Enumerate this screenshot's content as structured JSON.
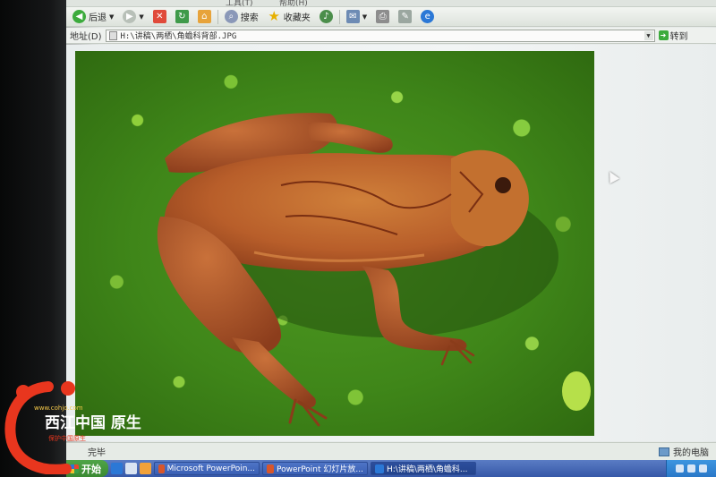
{
  "menubar": {
    "items": [
      "工具(T)",
      "帮助(H)"
    ]
  },
  "toolbar": {
    "back_label": "后退",
    "search_label": "搜索",
    "favorites_label": "收藏夹"
  },
  "address": {
    "label": "地址(D)",
    "value": "H:\\讲稿\\两栖\\角蟾科背部.JPG",
    "go_label": "转到"
  },
  "icons": {
    "back": "back-arrow-icon",
    "forward": "forward-arrow-icon",
    "stop": "stop-icon",
    "refresh": "refresh-icon",
    "home": "home-icon",
    "search": "search-icon",
    "favorites": "star-icon",
    "media": "media-icon",
    "mail": "mail-icon",
    "print": "print-icon",
    "edit": "edit-icon",
    "ie": "internet-explorer-icon"
  },
  "status": {
    "text": "完毕",
    "zone": "我的电脑"
  },
  "taskbar": {
    "start_label": "开始",
    "tasks": [
      {
        "label": "Microsoft PowerPoin..."
      },
      {
        "label": "PowerPoint 幻灯片放..."
      },
      {
        "label": "H:\\讲稿\\两栖\\角蟾科..."
      }
    ]
  },
  "watermark": {
    "site": "www.cohjo.com",
    "name": "西江中国原生",
    "tagline": "保护中国原生"
  },
  "colors": {
    "taskbar": "#3658a8",
    "start": "#3a8a32",
    "moss": "#4f9a22",
    "frog": "#c0632c"
  }
}
